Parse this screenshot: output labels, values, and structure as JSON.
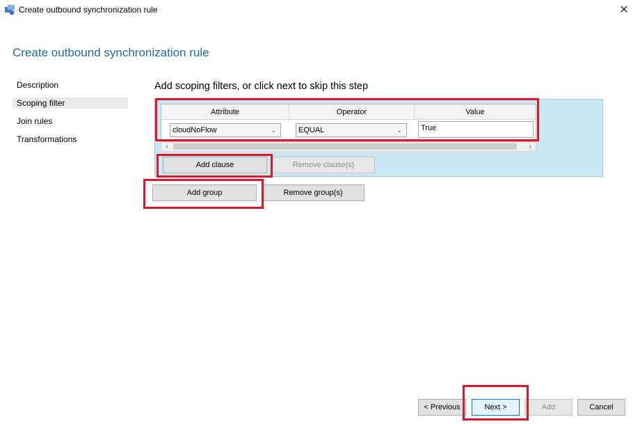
{
  "window": {
    "title": "Create outbound synchronization rule",
    "close_glyph": "✕"
  },
  "page": {
    "title": "Create outbound synchronization rule"
  },
  "nav": {
    "items": [
      {
        "label": "Description"
      },
      {
        "label": "Scoping filter"
      },
      {
        "label": "Join rules"
      },
      {
        "label": "Transformations"
      }
    ],
    "selected_label": "Scoping filter"
  },
  "step": {
    "heading": "Add scoping filters, or click next to skip this step"
  },
  "grid": {
    "columns": [
      "Attribute",
      "Operator",
      "Value"
    ],
    "rows": [
      {
        "attribute": "cloudNoFlow",
        "operator": "EQUAL",
        "value": "True"
      }
    ],
    "scroll_left_glyph": "‹",
    "scroll_right_glyph": "›",
    "dropdown_glyph": "⌄"
  },
  "buttons": {
    "add_clause": "Add clause",
    "remove_clause": "Remove clause(s)",
    "add_group": "Add group",
    "remove_group": "Remove group(s)",
    "previous": "< Previous",
    "next": "Next >",
    "add": "Add",
    "cancel": "Cancel"
  },
  "colors": {
    "title_accent": "#1f6aa6",
    "group_background": "#cbe7f4",
    "highlight": "#d9182a"
  },
  "icons": {
    "app": "sync-app-icon",
    "close": "close-icon"
  }
}
